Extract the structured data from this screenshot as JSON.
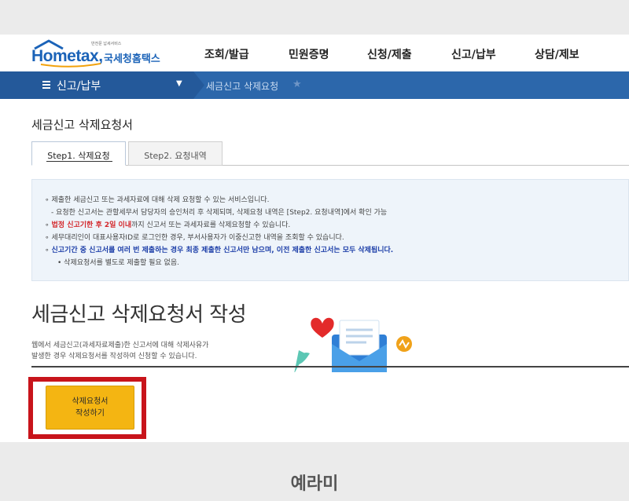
{
  "logo": {
    "brand_small": "반전문 납세서비스",
    "brand_en": "Hometax,",
    "brand_kr": "국세청홈택스"
  },
  "gnb": [
    "조회/발급",
    "민원증명",
    "신청/제출",
    "신고/납부",
    "상담/제보"
  ],
  "location": {
    "menu": "신고/납부",
    "current": "세금신고 삭제요청"
  },
  "page_title": "세금신고 삭제요청서",
  "tabs": [
    {
      "label": "Step1. 삭제요청"
    },
    {
      "label": "Step2. 요청내역"
    }
  ],
  "notice": {
    "l1": "∘ 제출한 세금신고 또는 과세자료에 대해 삭제 요청할 수 있는 서비스입니다.",
    "l2": "- 요청한 신고서는 관할세무서 담당자의 승인처리 후 삭제되며, 삭제요청 내역은 [Step2. 요청내역]에서 확인 가능",
    "l3_red": "법정 신고기한 후 2일 이내",
    "l3_rest": "까지 신고서 또는 과세자료를 삭제요청할 수 있습니다.",
    "l4": "∘ 세무대리인이 대표사용자ID로 로그인한 경우, 부서사용자가 이중신고한 내역을 조회할 수 있습니다.",
    "l5": "신고기간 중 신고서를 여러 번 제출하는 경우 최종 제출한 신고서만 남으며, 이전 제출한 신고서는 모두 삭제됩니다.",
    "l6": "• 삭제요청서를 별도로 제출할 필요 없음."
  },
  "section": {
    "title": "세금신고 삭제요청서 작성",
    "desc1": "웹에서 세금신고(과세자료제출)한 신고서에 대해 삭제사유가",
    "desc2": "발생한 경우 삭제요청서를 작성하여 신청할 수 있습니다."
  },
  "apply_button": {
    "line1": "삭제요청서",
    "line2": "작성하기"
  },
  "watermark": "예라미",
  "colors": {
    "primary_blue": "#2c67ab",
    "button_yellow": "#f4b512",
    "highlight_red": "#c8141b"
  }
}
